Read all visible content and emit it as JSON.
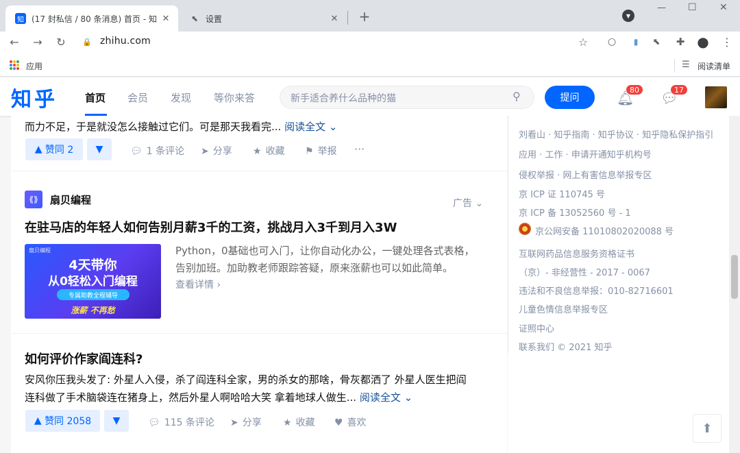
{
  "browser": {
    "tabs": [
      {
        "favicon": "知",
        "title": "(17 封私信 / 80 条消息) 首页 - 知"
      },
      {
        "title": "设置"
      }
    ],
    "new_tab": "+",
    "url": "zhihu.com",
    "bookmarks": {
      "apps_label": "应用",
      "reading_list_label": "阅读清单"
    }
  },
  "header": {
    "logo": "知乎",
    "nav": [
      "首页",
      "会员",
      "发现",
      "等你来答"
    ],
    "search_placeholder": "新手适合养什么品种的猫",
    "ask_button": "提问",
    "notification_count": "80",
    "message_count": "17"
  },
  "feed": {
    "item1": {
      "excerpt": "而力不足，于是就没怎么接触过它们。可是那天我看完...",
      "read_more": "阅读全文",
      "vote_label": "赞同 2",
      "actions": [
        "1 条评论",
        "分享",
        "收藏",
        "举报"
      ]
    },
    "ad": {
      "brand": "扇贝编程",
      "tag": "广告",
      "title": "在驻马店的年轻人如何告别月薪3千的工资，挑战月入3千到月入3W",
      "desc_line1": "Python，0基础也可入门，让你自动化办公，一键处理各式表格，",
      "desc_line2": "告别加班。加助教老师跟踪答疑，原来涨薪也可以如此简单。",
      "cta": "查看详情",
      "image": {
        "brand": "扇贝编程",
        "line1": "4天带你",
        "line2": "从0轻松入门编程",
        "pill": "专属助教全程辅导",
        "slogan": "涨薪 不再愁"
      }
    },
    "item2": {
      "title": "如何评价作家阎连科?",
      "excerpt_line1": "安风你压我头发了:  外星人入侵，杀了阎连科全家，男的杀女的那啥，骨灰都洒了 外星人医生把阎",
      "excerpt_line2": "连科做了手术脑袋连在猪身上，然后外星人啊哈哈大笑 拿着地球人做生...",
      "read_more": "阅读全文",
      "vote_label": "赞同 2058",
      "actions": [
        "115 条评论",
        "分享",
        "收藏",
        "喜欢"
      ]
    }
  },
  "sidebar": {
    "links": [
      "刘看山 · 知乎指南 · 知乎协议 · 知乎隐私保护指引",
      "应用 · 工作 · 申请开通知乎机构号",
      "侵权举报 · 网上有害信息举报专区",
      "京 ICP 证 110745 号",
      "京 ICP 备 13052560 号 - 1",
      "京公网安备 11010802020088 号",
      "互联网药品信息服务资格证书",
      "（京）- 非经营性 - 2017 - 0067",
      "违法和不良信息举报：010-82716601",
      "儿童色情信息举报专区",
      "证照中心",
      "联系我们 © 2021 知乎"
    ]
  }
}
